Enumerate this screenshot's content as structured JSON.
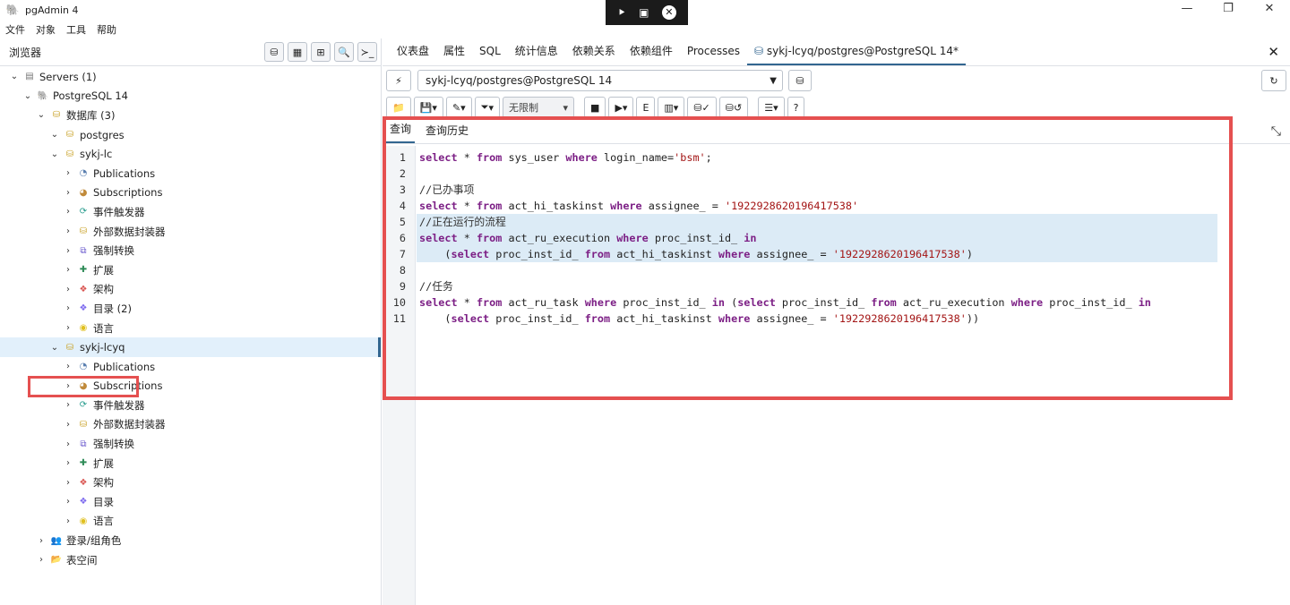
{
  "window": {
    "title": "pgAdmin 4",
    "controls": [
      "—",
      "❐",
      "✕"
    ]
  },
  "menu": [
    "文件",
    "对象",
    "工具",
    "帮助"
  ],
  "browser": {
    "label": "浏览器",
    "tree": [
      {
        "label": "Servers (1)",
        "indent": 0,
        "icon": "servers-icon"
      },
      {
        "label": "PostgreSQL 14",
        "indent": 1,
        "icon": "elephant-icon"
      },
      {
        "label": "数据库 (3)",
        "indent": 2,
        "icon": "database-icon"
      },
      {
        "label": "postgres",
        "indent": 3,
        "icon": "database-icon"
      },
      {
        "label": "sykj-lc",
        "indent": 3,
        "icon": "database-icon"
      },
      {
        "label": "Publications",
        "indent": 4,
        "icon": "publication-icon"
      },
      {
        "label": "Subscriptions",
        "indent": 4,
        "icon": "subscription-icon"
      },
      {
        "label": "事件触发器",
        "indent": 4,
        "icon": "event-trigger-icon"
      },
      {
        "label": "外部数据封装器",
        "indent": 4,
        "icon": "fdw-icon"
      },
      {
        "label": "强制转换",
        "indent": 4,
        "icon": "cast-icon"
      },
      {
        "label": "扩展",
        "indent": 4,
        "icon": "extension-icon"
      },
      {
        "label": "架构",
        "indent": 4,
        "icon": "schema-icon"
      },
      {
        "label": "目录 (2)",
        "indent": 4,
        "icon": "catalog-icon"
      },
      {
        "label": "语言",
        "indent": 4,
        "icon": "language-icon"
      },
      {
        "label": "sykj-lcyq",
        "indent": 3,
        "icon": "database-icon",
        "selected": true
      },
      {
        "label": "Publications",
        "indent": 4,
        "icon": "publication-icon"
      },
      {
        "label": "Subscriptions",
        "indent": 4,
        "icon": "subscription-icon"
      },
      {
        "label": "事件触发器",
        "indent": 4,
        "icon": "event-trigger-icon"
      },
      {
        "label": "外部数据封装器",
        "indent": 4,
        "icon": "fdw-icon"
      },
      {
        "label": "强制转换",
        "indent": 4,
        "icon": "cast-icon"
      },
      {
        "label": "扩展",
        "indent": 4,
        "icon": "extension-icon"
      },
      {
        "label": "架构",
        "indent": 4,
        "icon": "schema-icon"
      },
      {
        "label": "目录",
        "indent": 4,
        "icon": "catalog-icon"
      },
      {
        "label": "语言",
        "indent": 4,
        "icon": "language-icon"
      },
      {
        "label": "登录/组角色",
        "indent": 2,
        "icon": "roles-icon"
      },
      {
        "label": "表空间",
        "indent": 2,
        "icon": "tablespace-icon"
      }
    ]
  },
  "tabs": [
    "仪表盘",
    "属性",
    "SQL",
    "统计信息",
    "依赖关系",
    "依赖组件",
    "Processes",
    "sykj-lcyq/postgres@PostgreSQL 14*"
  ],
  "connection": {
    "value": "sykj-lcyq/postgres@PostgreSQL 14"
  },
  "query_toolbar": {
    "limit": "无限制"
  },
  "editor_tabs": [
    "查询",
    "查询历史"
  ],
  "code_lines": [
    [
      [
        "kw",
        "select"
      ],
      [
        "p",
        " * "
      ],
      [
        "kw",
        "from"
      ],
      [
        "p",
        " sys_user "
      ],
      [
        "kw",
        "where"
      ],
      [
        "p",
        " login_name="
      ],
      [
        "str",
        "'bsm'"
      ],
      [
        "p",
        ";"
      ]
    ],
    [],
    [
      [
        "cm",
        "//已办事项"
      ]
    ],
    [
      [
        "kw",
        "select"
      ],
      [
        "p",
        " * "
      ],
      [
        "kw",
        "from"
      ],
      [
        "p",
        " act_hi_taskinst "
      ],
      [
        "kw",
        "where"
      ],
      [
        "p",
        " assignee_ = "
      ],
      [
        "str",
        "'1922928620196417538'"
      ]
    ],
    [
      [
        "cm",
        "//正在运行的流程"
      ]
    ],
    [
      [
        "kw",
        "select"
      ],
      [
        "p",
        " * "
      ],
      [
        "kw",
        "from"
      ],
      [
        "p",
        " act_ru_execution "
      ],
      [
        "kw",
        "where"
      ],
      [
        "p",
        " proc_inst_id_ "
      ],
      [
        "kw",
        "in"
      ]
    ],
    [
      [
        "p",
        "    ("
      ],
      [
        "kw",
        "select"
      ],
      [
        "p",
        " proc_inst_id_ "
      ],
      [
        "kw",
        "from"
      ],
      [
        "p",
        " act_hi_taskinst "
      ],
      [
        "kw",
        "where"
      ],
      [
        "p",
        " assignee_ = "
      ],
      [
        "str",
        "'1922928620196417538'"
      ],
      [
        "p",
        ")"
      ]
    ],
    [],
    [
      [
        "cm",
        "//任务"
      ]
    ],
    [
      [
        "kw",
        "select"
      ],
      [
        "p",
        " * "
      ],
      [
        "kw",
        "from"
      ],
      [
        "p",
        " act_ru_task "
      ],
      [
        "kw",
        "where"
      ],
      [
        "p",
        " proc_inst_id_ "
      ],
      [
        "kw",
        "in"
      ],
      [
        "p",
        " ("
      ],
      [
        "kw",
        "select"
      ],
      [
        "p",
        " proc_inst_id_ "
      ],
      [
        "kw",
        "from"
      ],
      [
        "p",
        " act_ru_execution "
      ],
      [
        "kw",
        "where"
      ],
      [
        "p",
        " proc_inst_id_ "
      ],
      [
        "kw",
        "in"
      ]
    ],
    [
      [
        "p",
        "    ("
      ],
      [
        "kw",
        "select"
      ],
      [
        "p",
        " proc_inst_id_ "
      ],
      [
        "kw",
        "from"
      ],
      [
        "p",
        " act_hi_taskinst "
      ],
      [
        "kw",
        "where"
      ],
      [
        "p",
        " assignee_ = "
      ],
      [
        "str",
        "'1922928620196417538'"
      ],
      [
        "p",
        "))"
      ]
    ]
  ],
  "highlighted_lines": [
    5,
    6,
    7
  ]
}
